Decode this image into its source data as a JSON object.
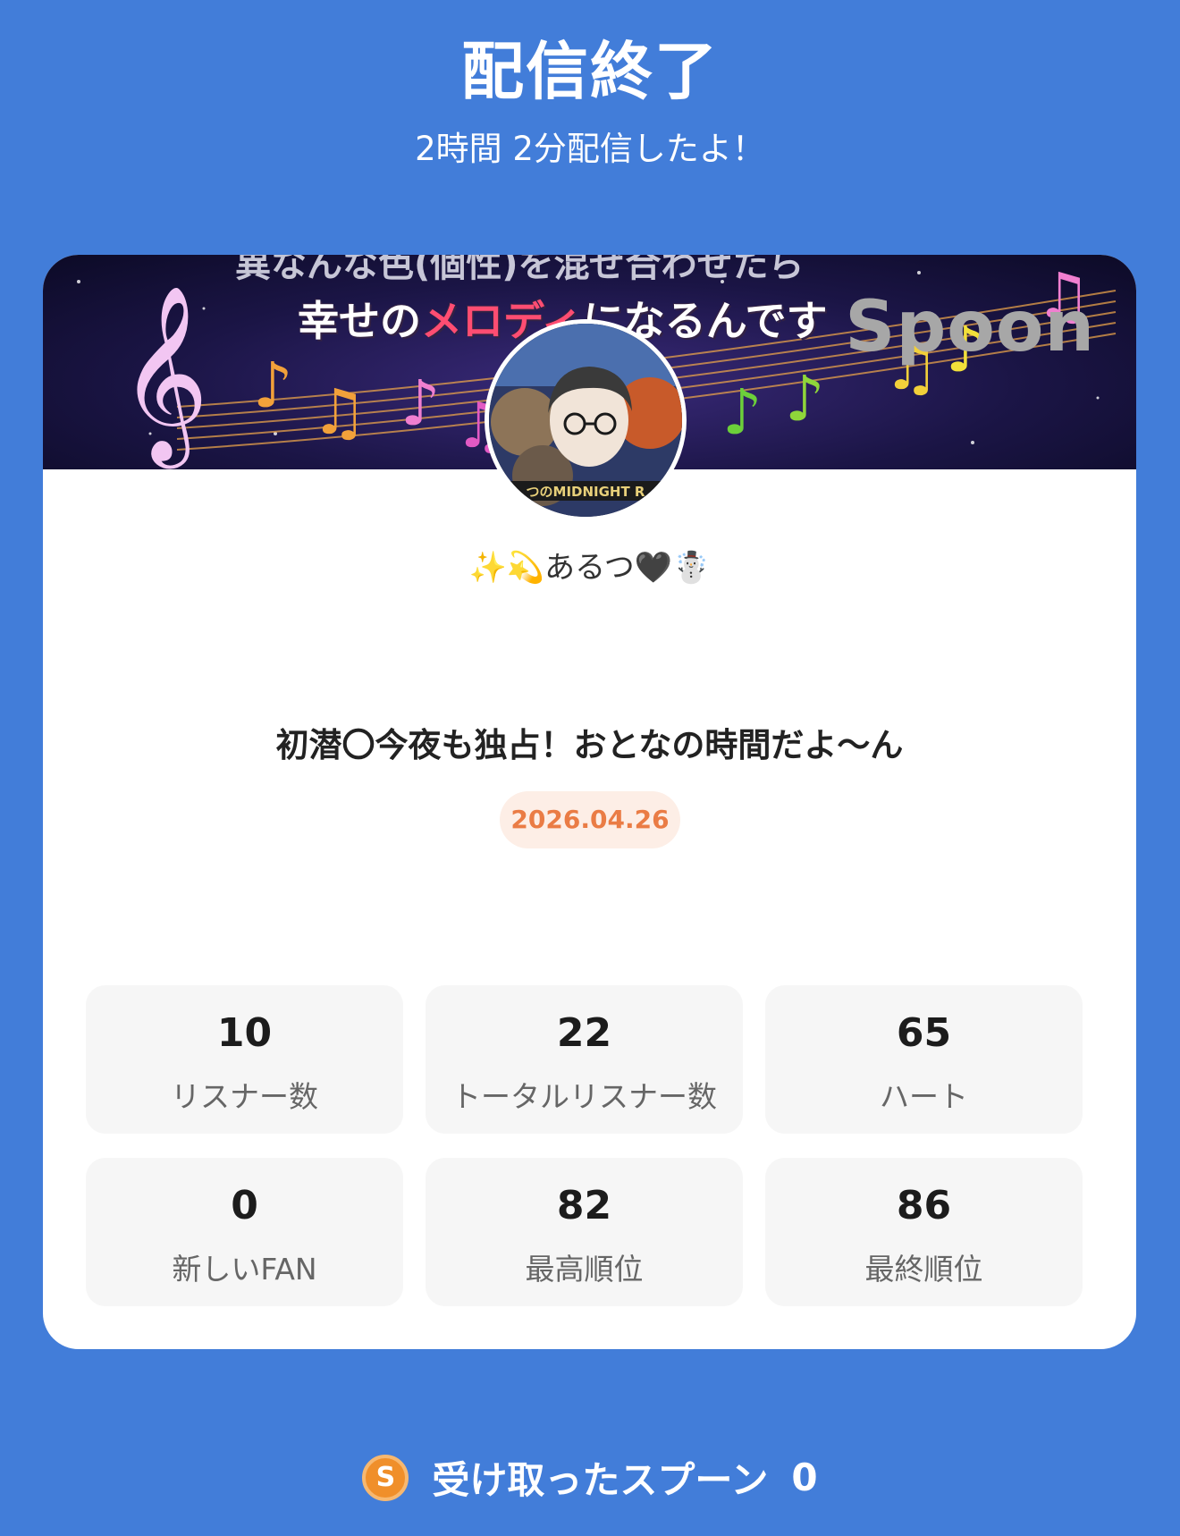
{
  "header": {
    "title": "配信終了",
    "subtitle": "2時間 2分配信したよ！"
  },
  "banner": {
    "text_top": "異なんな色(個性)を混ぜ合わせたら",
    "text_pre": "幸せの",
    "text_highlight": "メロディ",
    "text_post": "になるんです",
    "brand": "Spoon"
  },
  "profile": {
    "avatar_text": "つのMIDNIGHT R",
    "username": "✨💫あるつ🖤☃️"
  },
  "broadcast": {
    "title": "初潜〇今夜も独占！おとなの時間だよ〜ん",
    "date": "2026.04.26"
  },
  "stats": [
    {
      "value": "10",
      "label": "リスナー数"
    },
    {
      "value": "22",
      "label": "トータルリスナー数"
    },
    {
      "value": "65",
      "label": "ハート"
    },
    {
      "value": "0",
      "label": "新しいFAN"
    },
    {
      "value": "82",
      "label": "最高順位"
    },
    {
      "value": "86",
      "label": "最終順位"
    }
  ],
  "footer": {
    "coin_letter": "S",
    "label": "受け取ったスプーン",
    "value": "0"
  },
  "colors": {
    "background": "#427dd9",
    "card": "#ffffff",
    "date_text": "#ea7c45",
    "date_bg": "#fdeee6",
    "coin": "#f08f2a"
  }
}
